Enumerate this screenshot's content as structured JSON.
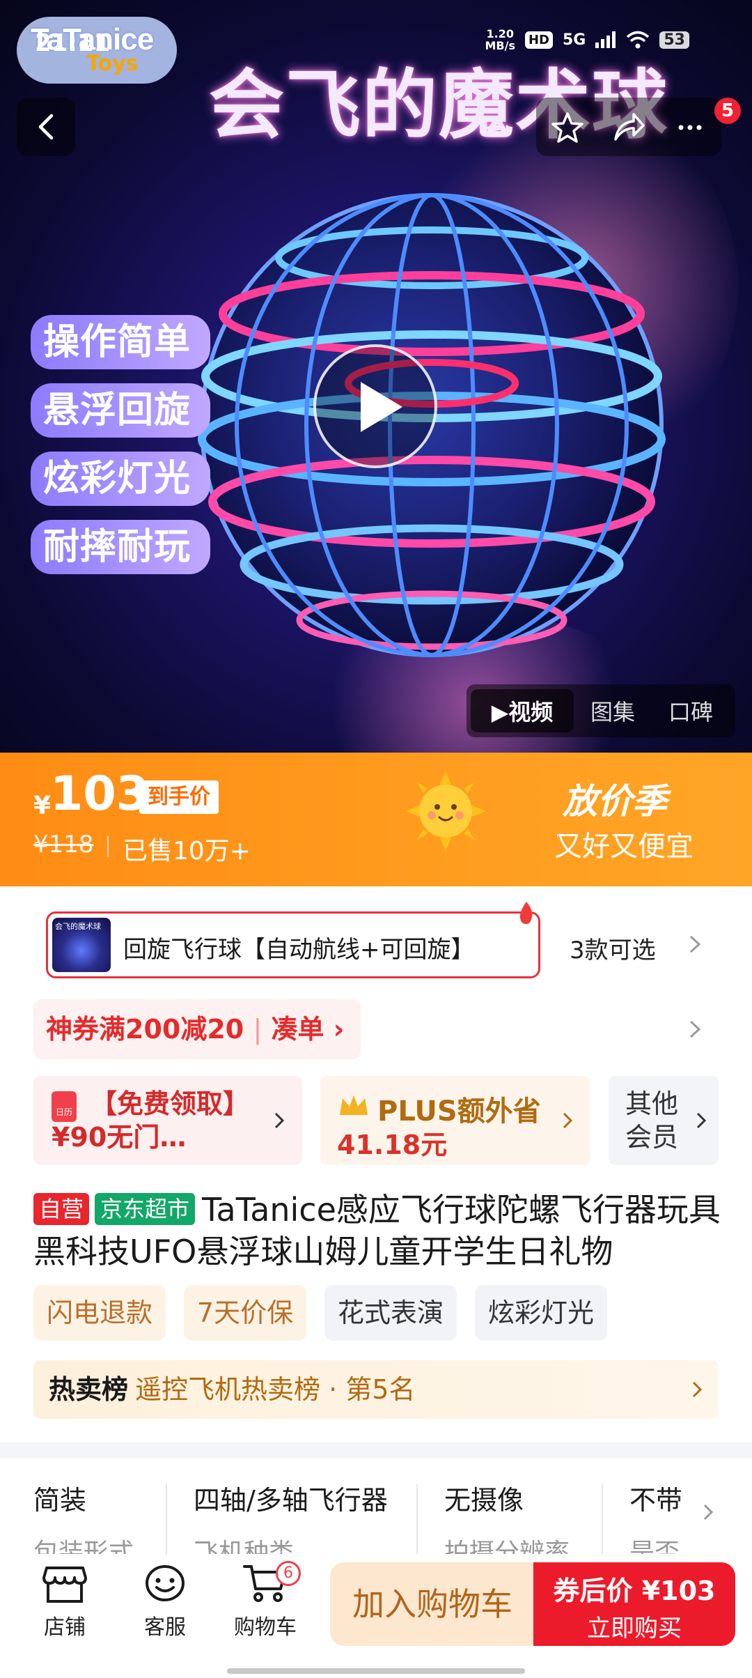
{
  "status_bar": {
    "time": "21:11",
    "net_speed_value": "1.20",
    "net_speed_unit": "MB/s",
    "hd": "HD",
    "network": "5G",
    "battery": "53"
  },
  "hero": {
    "brand_main": "TaTanice",
    "brand_sub": "Toys",
    "title": "会飞的魔术球",
    "features": [
      "操作简单",
      "悬浮回旋",
      "炫彩灯光",
      "耐摔耐玩"
    ],
    "more_badge": "5",
    "media_tabs": [
      {
        "label": "▶视频",
        "active": true
      },
      {
        "label": "图集",
        "active": false
      },
      {
        "label": "口碑",
        "active": false
      }
    ]
  },
  "price_banner": {
    "currency": "¥",
    "price": "103",
    "price_tag": "到手价",
    "original_price": "¥118",
    "sold": "已售10万+",
    "season": "放价季",
    "slogan": "又好又便宜"
  },
  "sku": {
    "thumb_text": "会飞的魔术球",
    "label": "回旋飞行球【自动航线+可回旋】",
    "options": "3款可选"
  },
  "coupon": {
    "text": "神券满200减20",
    "sep": "|",
    "action": "凑单 ›"
  },
  "promos": [
    {
      "icon_text": "日历",
      "text": "【免费领取】¥90无门…"
    },
    {
      "title": "PLUS额外省",
      "amount": "41.18元"
    },
    {
      "text": "其他会员"
    }
  ],
  "product": {
    "tag_self": "自营",
    "tag_store": "京东超市",
    "title": "TaTanice感应飞行球陀螺飞行器玩具黑科技UFO悬浮球山姆儿童开学生日礼物"
  },
  "service_tags": [
    "闪电退款",
    "7天价保",
    "花式表演",
    "炫彩灯光"
  ],
  "ranking": {
    "label": "热卖榜",
    "text": "遥控飞机热卖榜 · 第5名"
  },
  "specs": [
    {
      "value": "简装",
      "key": "包装形式"
    },
    {
      "value": "四轴/多轴飞行器",
      "key": "飞机种类"
    },
    {
      "value": "无摄像",
      "key": "拍摄分辨率"
    },
    {
      "value": "不带",
      "key": "是否"
    }
  ],
  "bottom_bar": {
    "store": "店铺",
    "service": "客服",
    "cart": "购物车",
    "cart_count": "6",
    "add_to_cart": "加入购物车",
    "buy_price": "券后价 ¥103",
    "buy_now": "立即购买"
  },
  "colors": {
    "accent_orange": "#ff8c14",
    "accent_red": "#ec1b2c",
    "jd_green": "#12a867"
  }
}
